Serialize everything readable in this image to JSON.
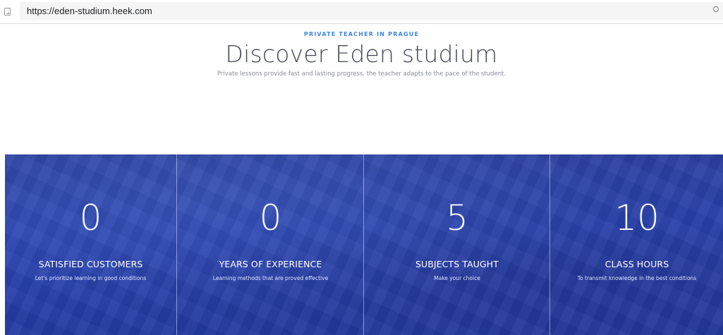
{
  "browser": {
    "url": "https://eden-studium.heek.com"
  },
  "hero": {
    "eyebrow": "PRIVATE TEACHER IN PRAGUE",
    "title": "Discover Eden studium",
    "subtitle": "Private lessons provide fast and lasting progress, the teacher adapts to the pace of the student."
  },
  "stats": [
    {
      "number": "0",
      "label": "SATISFIED CUSTOMERS",
      "description": "Let's prioritize learning in good conditions"
    },
    {
      "number": "0",
      "label": "YEARS OF EXPERIENCE",
      "description": "Learning methods that are proved effective"
    },
    {
      "number": "5",
      "label": "SUBJECTS TAUGHT",
      "description": "Make your choice"
    },
    {
      "number": "10",
      "label": "CLASS HOURS",
      "description": "To transmit knowledge in the best conditions"
    }
  ],
  "colors": {
    "accent": "#3f86e0",
    "title": "#45475a",
    "stats_background": "#2a44b0"
  }
}
